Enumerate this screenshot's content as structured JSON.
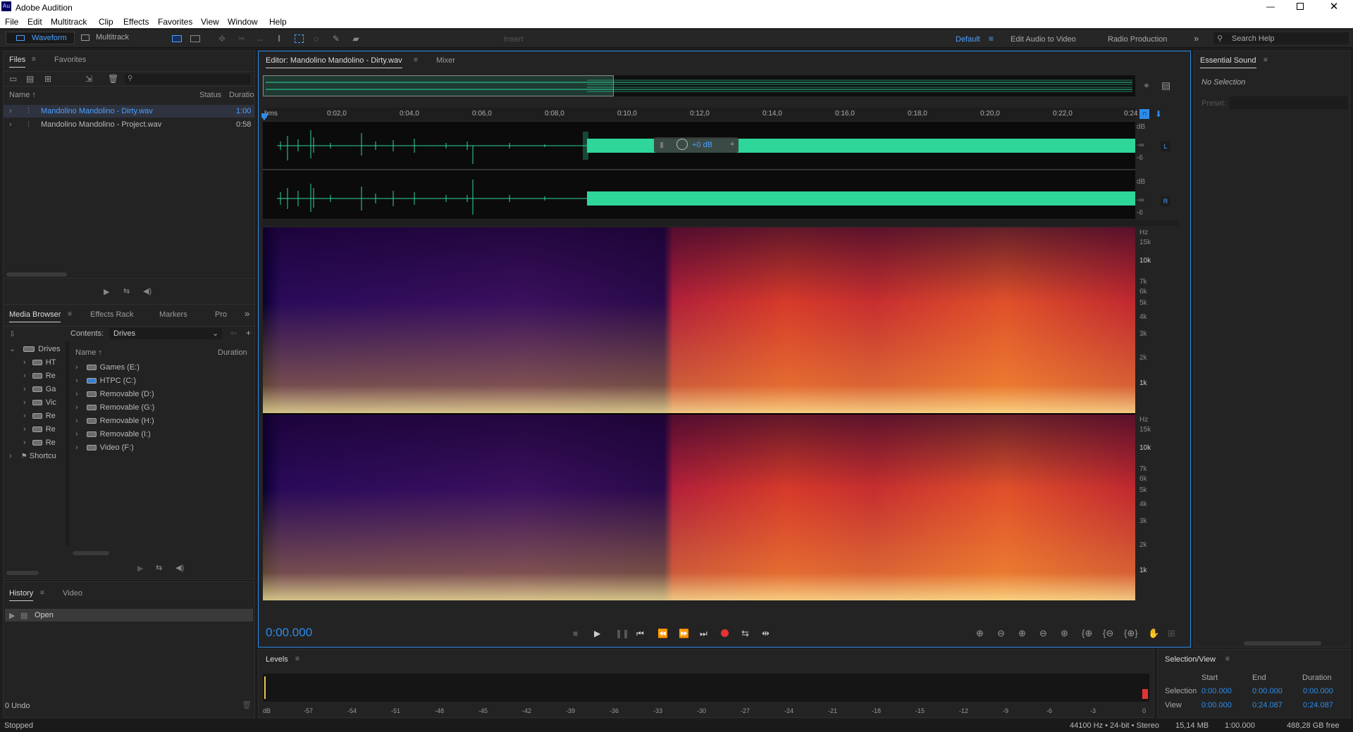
{
  "app": {
    "title": "Adobe Audition",
    "logo": "Au"
  },
  "menubar": [
    "File",
    "Edit",
    "Multitrack",
    "Clip",
    "Effects",
    "Favorites",
    "View",
    "Window",
    "Help"
  ],
  "window_controls": {
    "minimize": "minimize-icon",
    "restore": "restore-icon",
    "close": "close-icon"
  },
  "toolbar": {
    "waveform_label": "Waveform",
    "multitrack_label": "Multitrack",
    "insert_label": "Insert",
    "workspaces": [
      "Default",
      "Edit Audio to Video",
      "Radio Production"
    ],
    "search_placeholder": "Search Help"
  },
  "files_panel": {
    "tabs": [
      "Files",
      "Favorites"
    ],
    "columns": [
      "Name",
      "Status",
      "Duration"
    ],
    "rows": [
      {
        "name": "Mandolino Mandolino - Dirty.wav",
        "duration": "1:00",
        "selected": true
      },
      {
        "name": "Mandolino Mandolino - Project.wav",
        "duration": "0:58",
        "selected": false
      }
    ]
  },
  "media_panel": {
    "tabs": [
      "Media Browser",
      "Effects Rack",
      "Markers",
      "Pro"
    ],
    "contents_label": "Contents:",
    "contents_value": "Drives",
    "left_tree": [
      {
        "label": "Drives",
        "root": true
      },
      {
        "label": "HT"
      },
      {
        "label": "Re"
      },
      {
        "label": "Ga"
      },
      {
        "label": "Vic"
      },
      {
        "label": "Re"
      },
      {
        "label": "Re"
      },
      {
        "label": "Re"
      },
      {
        "label": "Shortcu",
        "root": true
      }
    ],
    "columns": [
      "Name",
      "Duration"
    ],
    "items": [
      "Games (E:)",
      "HTPC (C:)",
      "Removable (D:)",
      "Removable (G:)",
      "Removable (H:)",
      "Removable (I:)",
      "Video (F:)"
    ]
  },
  "history_panel": {
    "tabs": [
      "History",
      "Video"
    ],
    "items": [
      "Open"
    ],
    "undo_count": "0 Undo"
  },
  "editor": {
    "tabs": [
      "Editor: Mandolino Mandolino - Dirty.wav",
      "Mixer"
    ],
    "ruler_unit": "hms",
    "ruler_labels": [
      "0:02,0",
      "0:04,0",
      "0:06,0",
      "0:08,0",
      "0:10,0",
      "0:12,0",
      "0:14,0",
      "0:16,0",
      "0:18,0",
      "0:20,0",
      "0:22,0",
      "0:24"
    ],
    "db_labels": [
      "dB",
      "-∞",
      "-6"
    ],
    "channels": [
      "L",
      "R"
    ],
    "gain_hud": "+0 dB",
    "hz_labels": [
      "Hz",
      "15k",
      "10k",
      "7k",
      "6k",
      "5k",
      "4k",
      "3k",
      "2k",
      "1k"
    ],
    "time_display": "0:00.000"
  },
  "essential_sound": {
    "title": "Essential Sound",
    "no_selection": "No Selection",
    "preset_label": "Preset:"
  },
  "levels": {
    "title": "Levels",
    "scale": [
      "dB",
      "-57",
      "-54",
      "-51",
      "-48",
      "-45",
      "-42",
      "-39",
      "-36",
      "-33",
      "-30",
      "-27",
      "-24",
      "-21",
      "-18",
      "-15",
      "-12",
      "-9",
      "-6",
      "-3",
      "0"
    ]
  },
  "selection_view": {
    "title": "Selection/View",
    "headers": [
      "Start",
      "End",
      "Duration"
    ],
    "selection": {
      "label": "Selection",
      "start": "0:00.000",
      "end": "0:00.000",
      "duration": "0:00.000"
    },
    "view": {
      "label": "View",
      "start": "0:00.000",
      "end": "0:24.087",
      "duration": "0:24.087"
    }
  },
  "statusbar": {
    "left": "Stopped",
    "format": "44100 Hz • 24-bit • Stereo",
    "size": "15,14 MB",
    "duration": "1:00.000",
    "free": "488,28 GB free"
  },
  "colors": {
    "accent": "#2d8ceb",
    "waveform": "#2fd69a",
    "record": "#e53333",
    "panel": "#232323"
  }
}
